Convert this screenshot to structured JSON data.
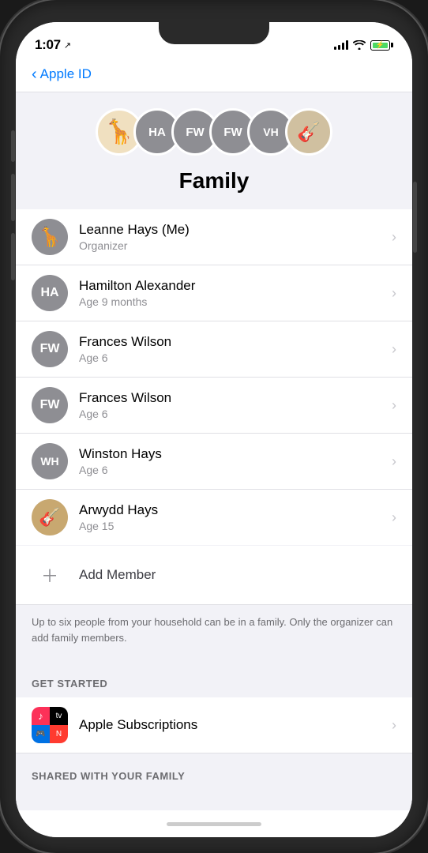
{
  "status_bar": {
    "time": "1:07",
    "location_icon": "↗"
  },
  "nav": {
    "back_label": "Apple ID"
  },
  "family_header": {
    "title": "Family",
    "avatars": [
      {
        "type": "giraffe",
        "initials": "",
        "label": "Leanne Hays avatar"
      },
      {
        "type": "initials",
        "initials": "HA",
        "label": "Hamilton Alexander avatar"
      },
      {
        "type": "initials",
        "initials": "FW",
        "label": "Frances Wilson avatar"
      },
      {
        "type": "initials",
        "initials": "FW",
        "label": "Frances Wilson avatar 2"
      },
      {
        "type": "initials",
        "initials": "VH",
        "label": "Winston Hays avatar"
      },
      {
        "type": "photo",
        "initials": "",
        "label": "Arwydd Hays avatar"
      }
    ]
  },
  "members": [
    {
      "name": "Leanne Hays  (Me)",
      "detail": "Organizer",
      "avatar_type": "giraffe",
      "initials": ""
    },
    {
      "name": "Hamilton Alexander",
      "detail": "Age 9 months",
      "avatar_type": "initials",
      "initials": "HA"
    },
    {
      "name": "Frances Wilson",
      "detail": "Age 6",
      "avatar_type": "initials",
      "initials": "FW"
    },
    {
      "name": "Frances Wilson",
      "detail": "Age 6",
      "avatar_type": "initials",
      "initials": "FW"
    },
    {
      "name": "Winston Hays",
      "detail": "Age 6",
      "avatar_type": "initials",
      "initials": "WH"
    },
    {
      "name": "Arwydd Hays",
      "detail": "Age 15",
      "avatar_type": "photo",
      "initials": ""
    }
  ],
  "add_member": {
    "label": "Add Member"
  },
  "info": {
    "text": "Up to six people from your household can be in a family. Only the organizer can add family members."
  },
  "get_started": {
    "section_label": "GET STARTED",
    "subscription": {
      "name": "Apple Subscriptions"
    }
  },
  "shared_section": {
    "label": "SHARED WITH YOUR FAMILY"
  }
}
